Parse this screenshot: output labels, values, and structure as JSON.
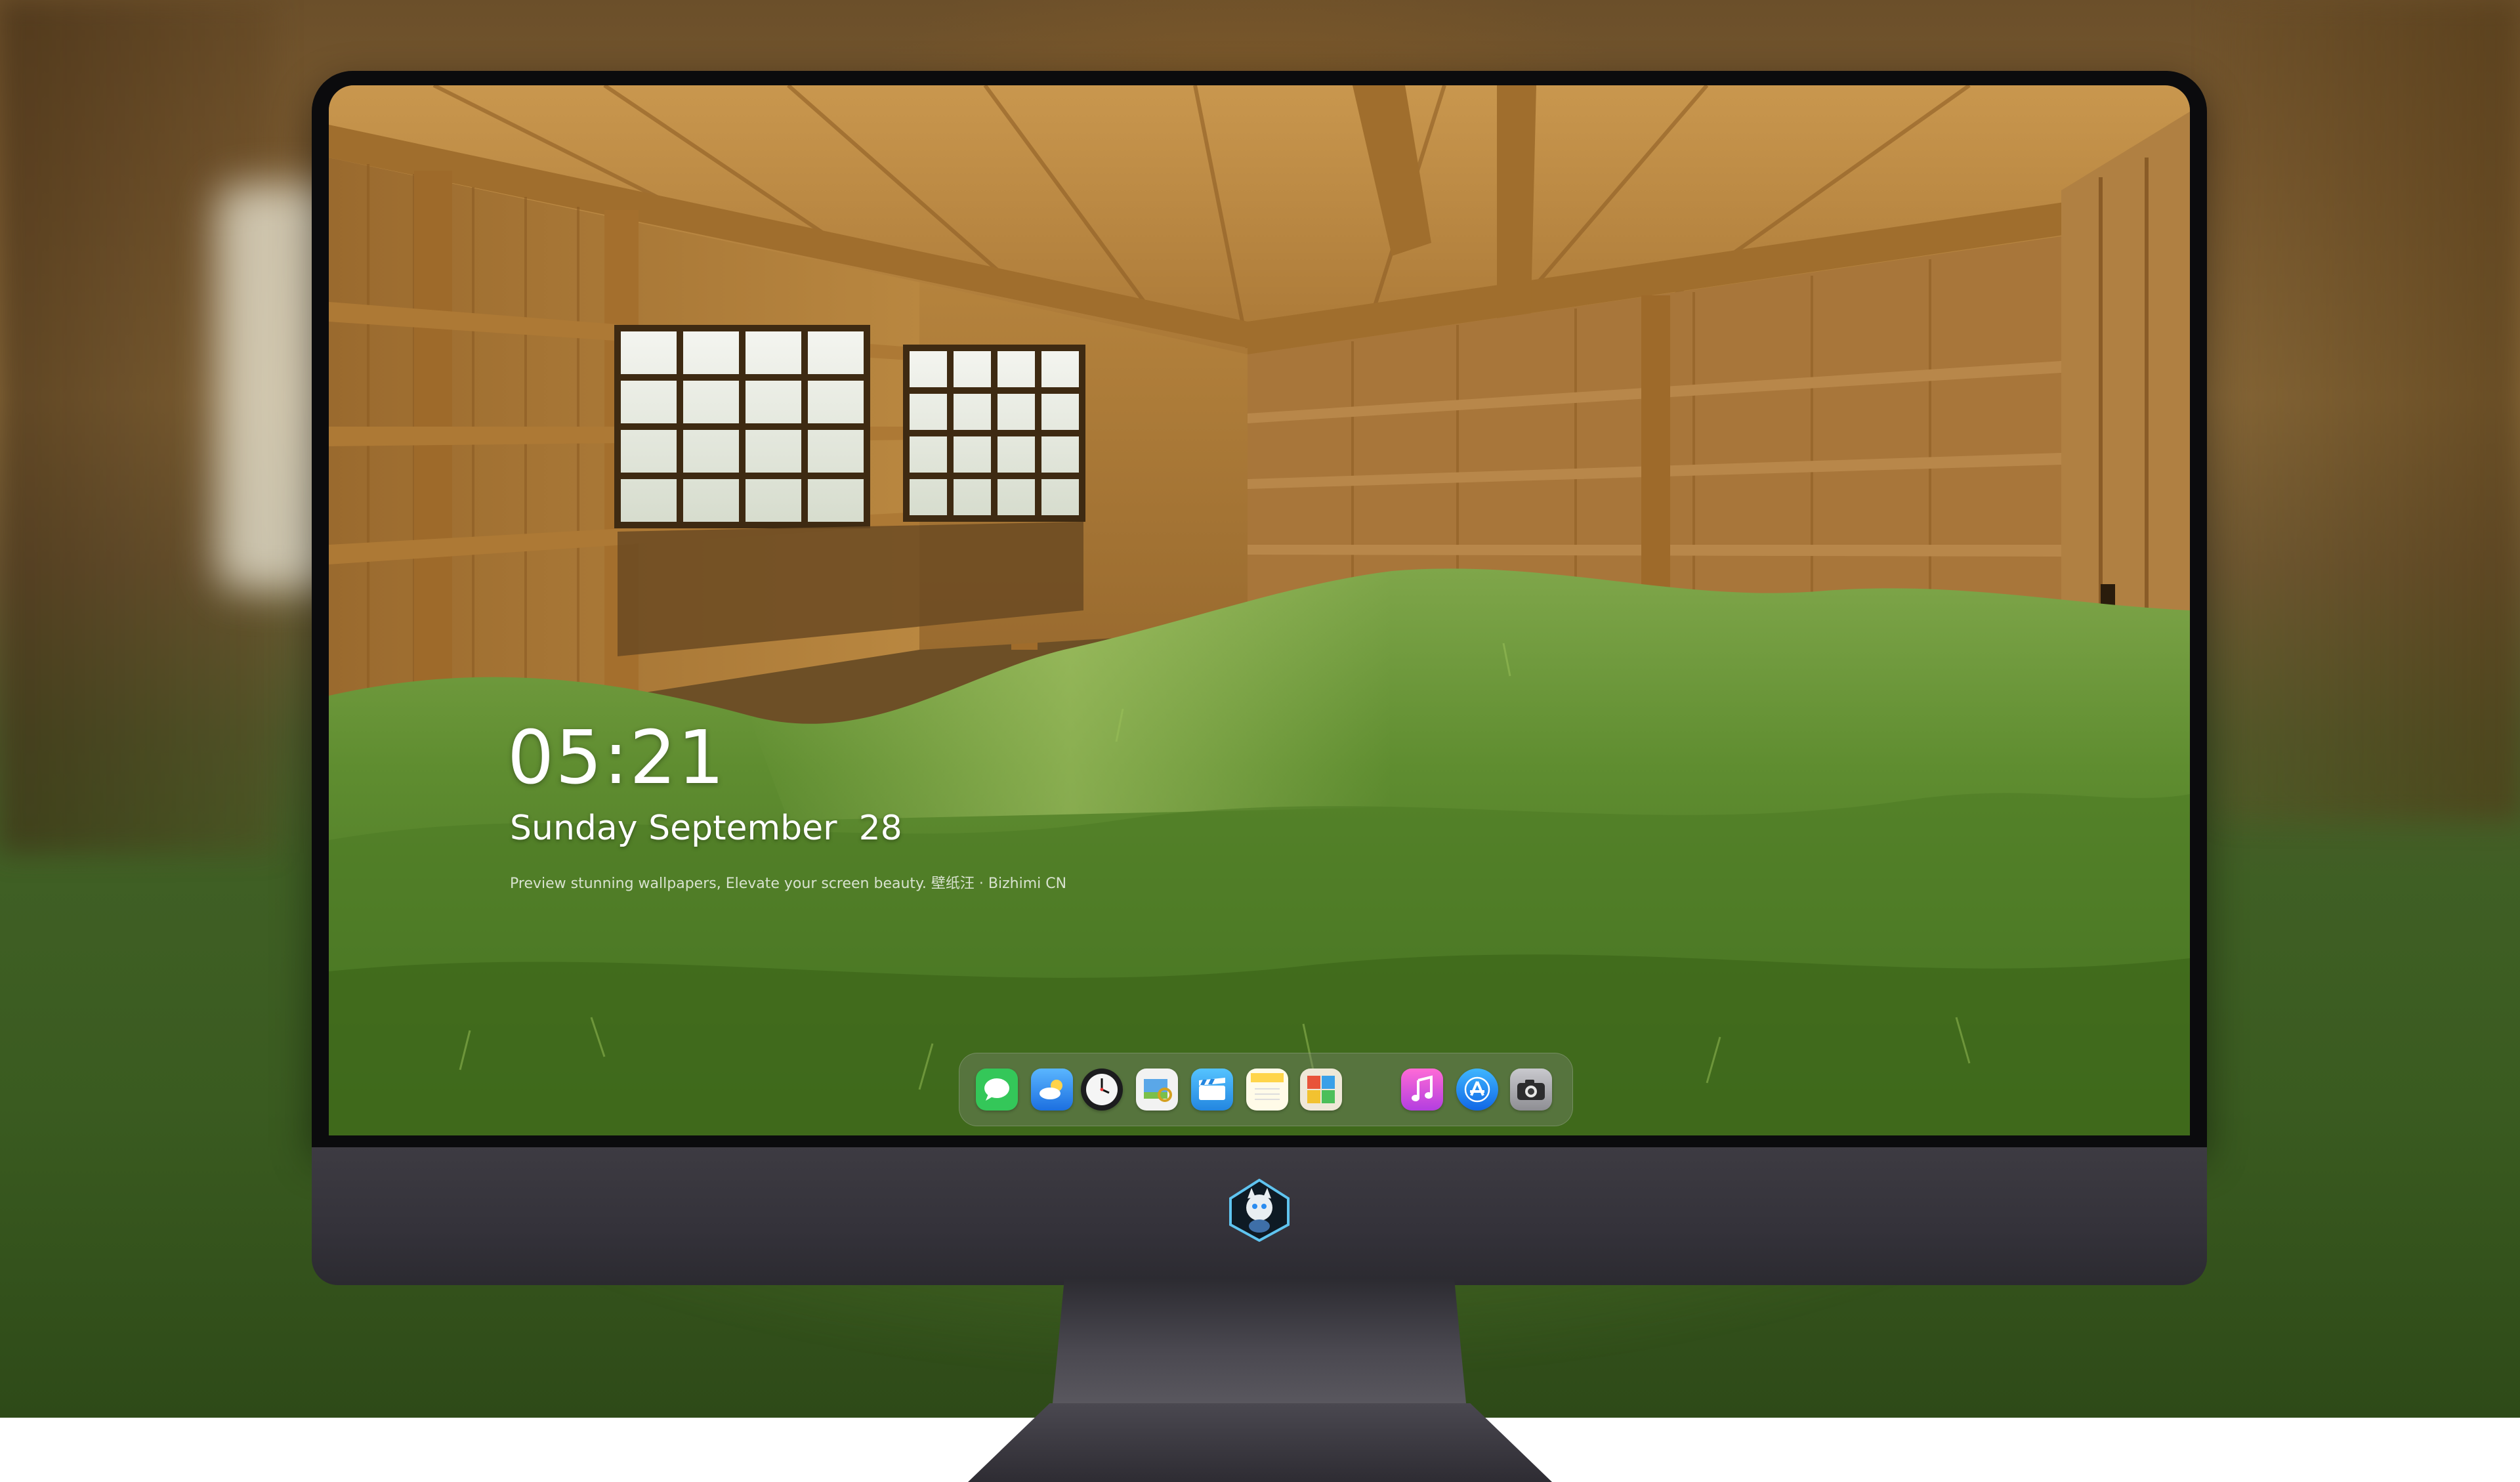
{
  "lockscreen": {
    "time": "05:21",
    "date": "Sunday September  28",
    "tagline": "Preview stunning wallpapers, Elevate your screen beauty. 壁纸汪 · Bizhimi CN"
  },
  "dock": {
    "apps": [
      {
        "icon": "messages-icon",
        "color": "#34c759"
      },
      {
        "icon": "weather-icon",
        "color": "#2a8cf0"
      },
      {
        "icon": "clock-icon",
        "color": "#1c1c1e"
      },
      {
        "icon": "preview-icon",
        "color": "#f2c94c"
      },
      {
        "icon": "clips-icon",
        "color": "#3aa0e8"
      },
      {
        "icon": "notes-icon",
        "color": "#ffd54a"
      },
      {
        "icon": "photo-booth-icon",
        "color": "#e9e3d6"
      },
      {
        "icon": "music-icon",
        "color": "#d84ad8"
      },
      {
        "icon": "app-store-icon",
        "color": "#1e88f5"
      },
      {
        "icon": "camera-icon",
        "color": "#8e8e93"
      }
    ]
  },
  "monitor": {
    "bezel_color": "#0b0b0d",
    "chin_color": "#3a3840",
    "logo_icon": "mascot-logo-icon"
  }
}
